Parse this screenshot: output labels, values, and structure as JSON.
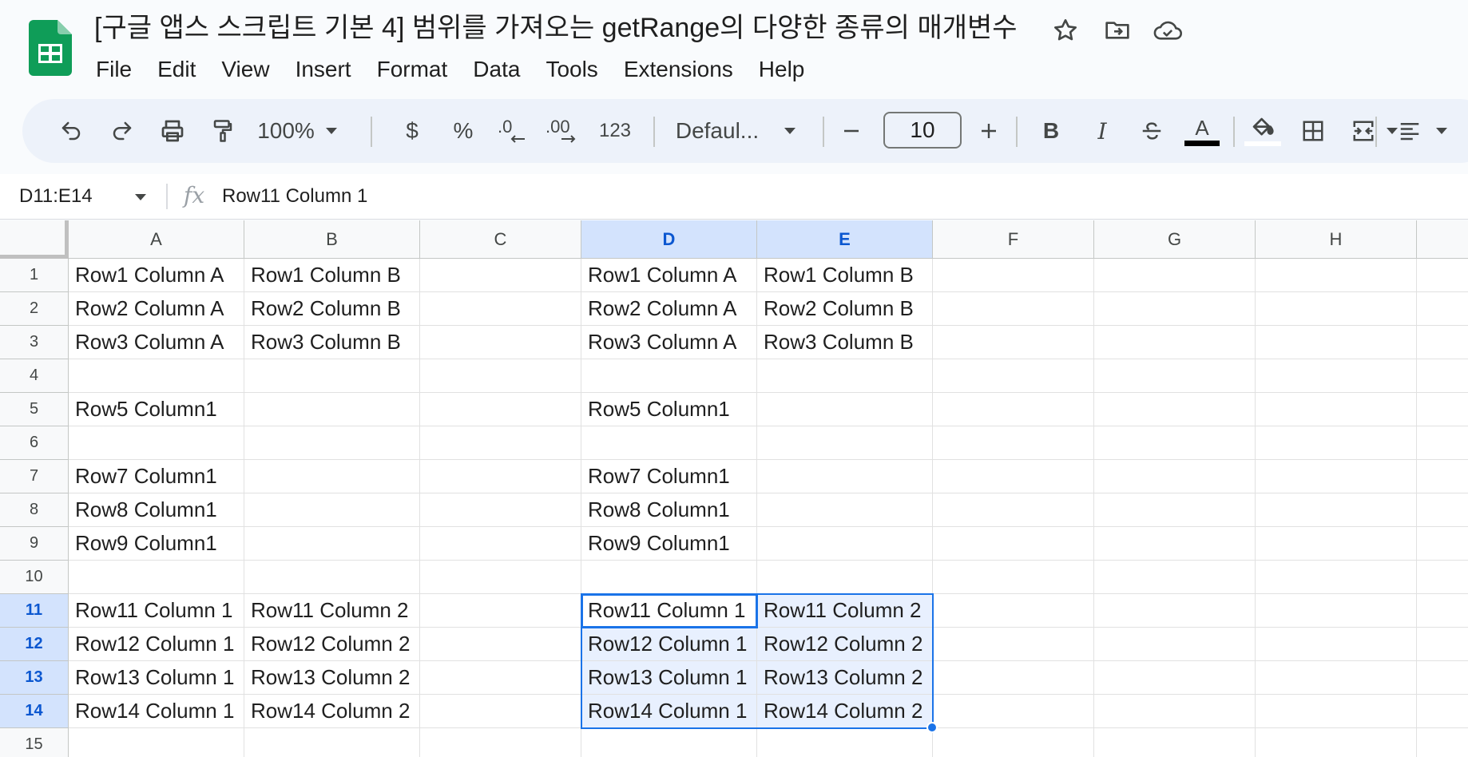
{
  "app": {
    "title": "[구글 앱스 스크립트 기본 4] 범위를 가져오는 getRange의 다양한 종류의 매개변수",
    "logo_icon": "google-sheets-logo",
    "brand_color": "#0f9d58",
    "accent_color": "#1a73e8"
  },
  "menu": [
    "File",
    "Edit",
    "View",
    "Insert",
    "Format",
    "Data",
    "Tools",
    "Extensions",
    "Help"
  ],
  "toolbar": {
    "zoom": "100%",
    "currency": "$",
    "percent": "%",
    "decrease_decimal": ".0",
    "increase_decimal": ".00",
    "number_format": "123",
    "font": "Defaul...",
    "font_size": "10",
    "bold": "B",
    "italic": "I",
    "text_color_glyph": "A",
    "icons": [
      "undo-icon",
      "redo-icon",
      "print-icon",
      "paint-format-icon",
      "bold-icon",
      "italic-icon",
      "strikethrough-icon",
      "text-color-icon",
      "fill-color-icon",
      "borders-icon",
      "merge-cells-icon",
      "align-icon"
    ]
  },
  "formula_bar": {
    "name_box": "D11:E14",
    "fx": "fx",
    "content": "Row11 Column 1"
  },
  "sheet": {
    "columns": [
      "A",
      "B",
      "C",
      "D",
      "E",
      "F",
      "G",
      "H"
    ],
    "selected_columns": [
      "D",
      "E"
    ],
    "row_numbers": [
      "1",
      "2",
      "3",
      "4",
      "5",
      "6",
      "7",
      "8",
      "9",
      "10",
      "11",
      "12",
      "13",
      "14",
      "15"
    ],
    "selected_rows": [
      "11",
      "12",
      "13",
      "14"
    ],
    "rows": [
      [
        "Row1 Column A",
        "Row1 Column B",
        "",
        "Row1 Column A",
        "Row1 Column B",
        "",
        "",
        ""
      ],
      [
        "Row2 Column A",
        "Row2 Column B",
        "",
        "Row2 Column A",
        "Row2 Column B",
        "",
        "",
        ""
      ],
      [
        "Row3 Column A",
        "Row3 Column B",
        "",
        "Row3 Column A",
        "Row3 Column B",
        "",
        "",
        ""
      ],
      [
        "",
        "",
        "",
        "",
        "",
        "",
        "",
        ""
      ],
      [
        "Row5 Column1",
        "",
        "",
        "Row5 Column1",
        "",
        "",
        "",
        ""
      ],
      [
        "",
        "",
        "",
        "",
        "",
        "",
        "",
        ""
      ],
      [
        "Row7 Column1",
        "",
        "",
        "Row7 Column1",
        "",
        "",
        "",
        ""
      ],
      [
        "Row8 Column1",
        "",
        "",
        "Row8 Column1",
        "",
        "",
        "",
        ""
      ],
      [
        "Row9 Column1",
        "",
        "",
        "Row9 Column1",
        "",
        "",
        "",
        ""
      ],
      [
        "",
        "",
        "",
        "",
        "",
        "",
        "",
        ""
      ],
      [
        "Row11 Column 1",
        "Row11 Column 2",
        "",
        "Row11 Column 1",
        "Row11 Column 2",
        "",
        "",
        ""
      ],
      [
        "Row12 Column 1",
        "Row12 Column 2",
        "",
        "Row12 Column 1",
        "Row12 Column 2",
        "",
        "",
        ""
      ],
      [
        "Row13 Column 1",
        "Row13 Column 2",
        "",
        "Row13 Column 1",
        "Row13 Column 2",
        "",
        "",
        ""
      ],
      [
        "Row14 Column 1",
        "Row14 Column 2",
        "",
        "Row14 Column 1",
        "Row14 Column 2",
        "",
        "",
        ""
      ],
      [
        "",
        "",
        "",
        "",
        "",
        "",
        "",
        ""
      ]
    ],
    "selection": "D11:E14",
    "active_cell": "D11"
  }
}
